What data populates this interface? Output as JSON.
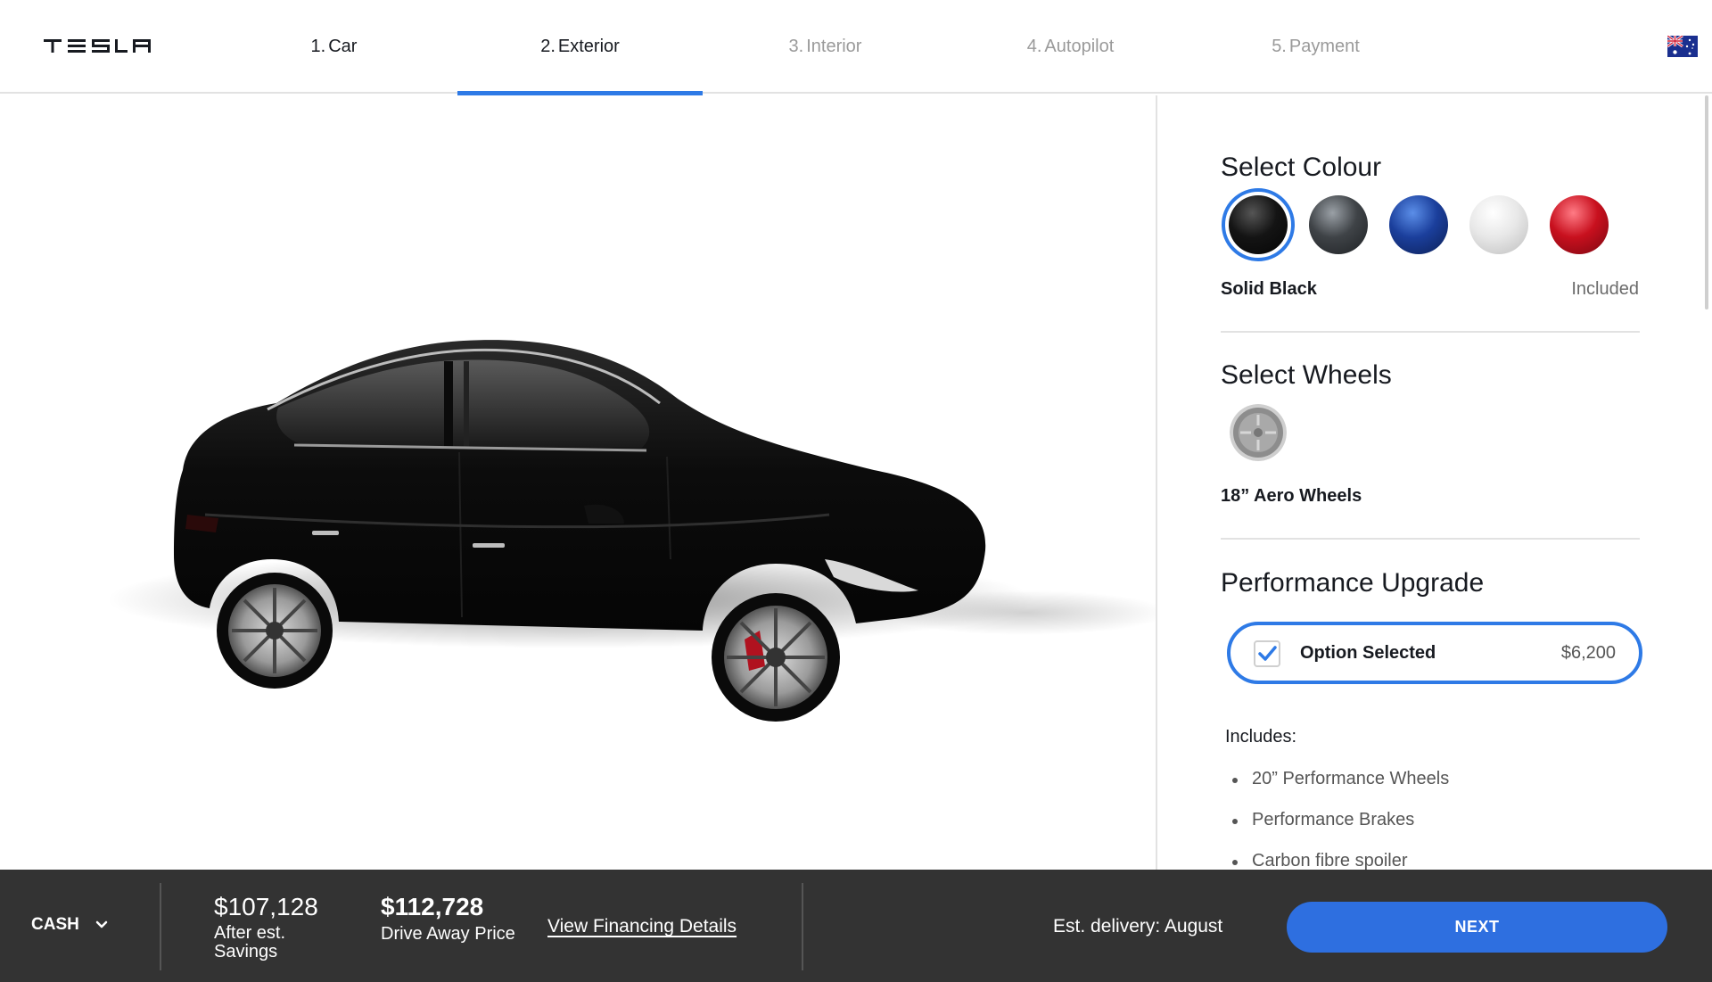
{
  "brand": {
    "logo_text": "TESLA",
    "logo_icon": "tesla-wordmark"
  },
  "nav": {
    "tabs": [
      {
        "num": "1.",
        "label": "Car",
        "state": "done"
      },
      {
        "num": "2.",
        "label": "Exterior",
        "state": "active"
      },
      {
        "num": "3.",
        "label": "Interior",
        "state": "pending"
      },
      {
        "num": "4.",
        "label": "Autopilot",
        "state": "pending"
      },
      {
        "num": "5.",
        "label": "Payment",
        "state": "pending"
      }
    ],
    "region_icon": "australia-flag-icon"
  },
  "colour": {
    "title": "Select Colour",
    "swatches": [
      {
        "name": "black-swatch",
        "color": "#111111",
        "selected": true
      },
      {
        "name": "grey-swatch",
        "color": "#3f4347"
      },
      {
        "name": "blue-swatch",
        "color": "#1b3f9c"
      },
      {
        "name": "white-swatch",
        "color": "#e8e8e8"
      },
      {
        "name": "red-swatch",
        "color": "#c8101e"
      }
    ],
    "selected_name": "Solid Black",
    "selected_price": "Included"
  },
  "wheels": {
    "title": "Select Wheels",
    "selected_name": "18” Aero Wheels"
  },
  "performance": {
    "title": "Performance Upgrade",
    "option_label": "Option Selected",
    "option_price": "$6,200",
    "checked": true,
    "includes_title": "Includes:",
    "includes": [
      "20” Performance Wheels",
      "Performance Brakes",
      "Carbon fibre spoiler"
    ]
  },
  "footer": {
    "payment_type": "CASH",
    "after_savings_price": "$107,128",
    "after_savings_label": "After est. Savings",
    "drive_away_price": "$112,728",
    "drive_away_label": "Drive Away Price",
    "financing_link": "View Financing Details",
    "delivery": "Est. delivery: August",
    "next_label": "NEXT"
  },
  "colors": {
    "accent": "#2e7ae6",
    "footer_bg": "#333333",
    "next_button": "#2e6fe0"
  }
}
